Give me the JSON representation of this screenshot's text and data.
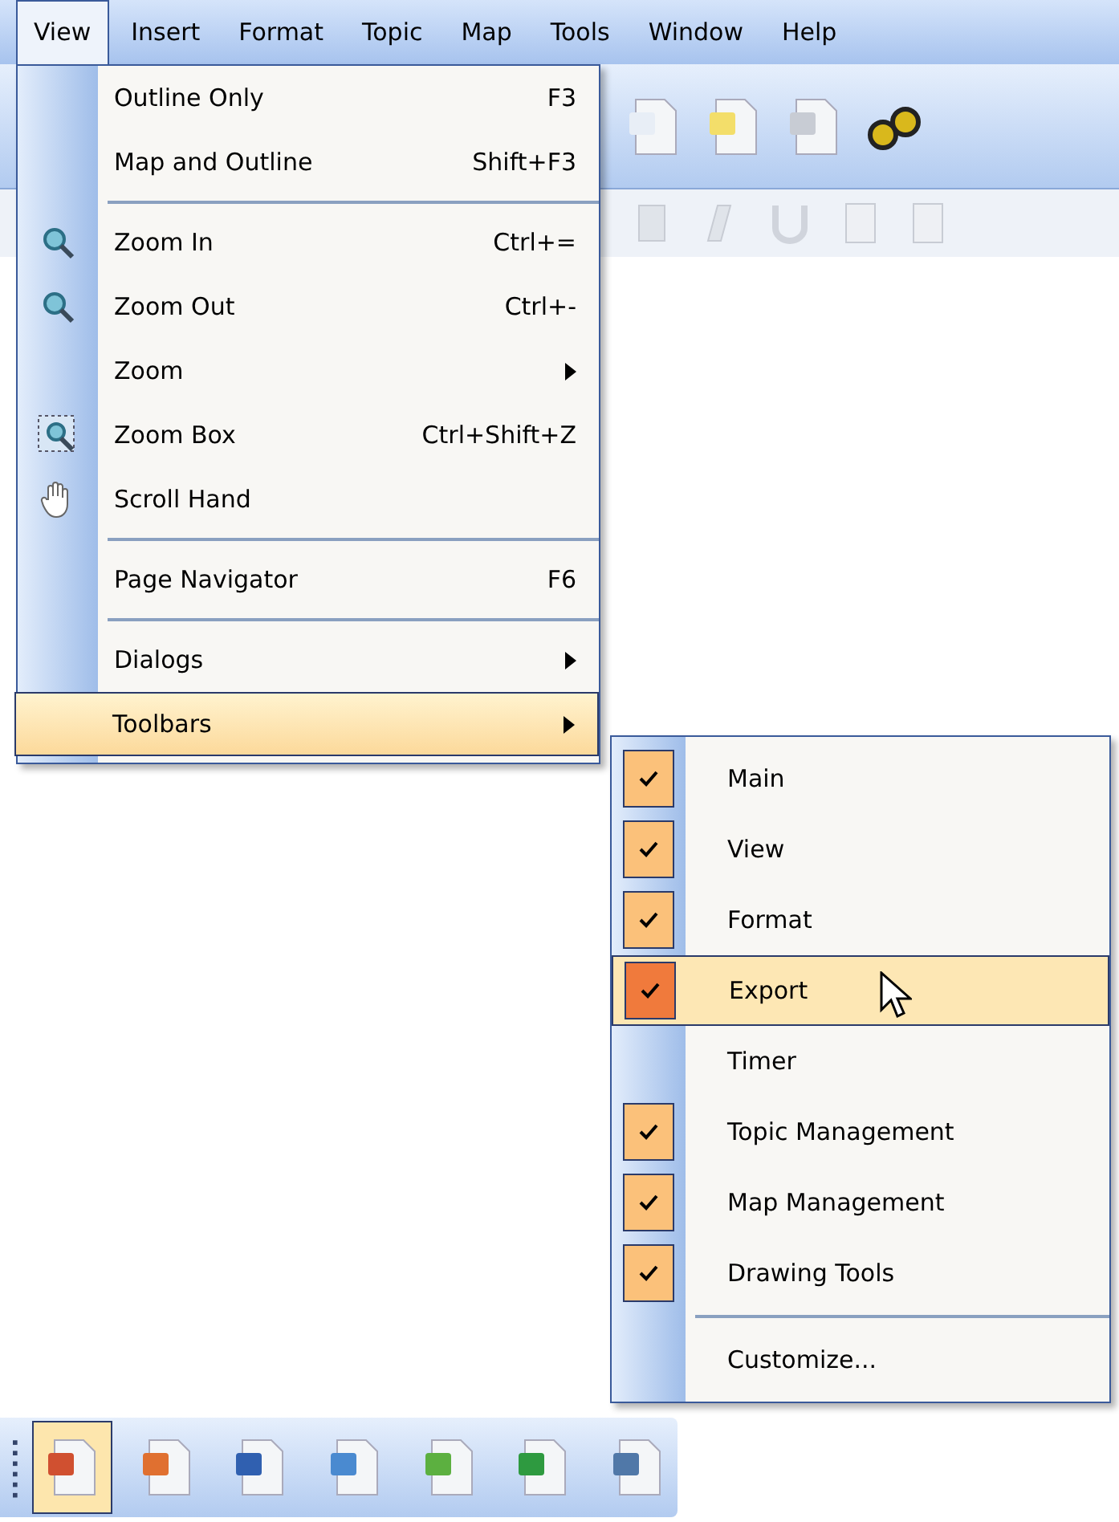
{
  "menubar": [
    {
      "label": "View",
      "selected": true
    },
    {
      "label": "Insert",
      "selected": false
    },
    {
      "label": "Format",
      "selected": false
    },
    {
      "label": "Topic",
      "selected": false
    },
    {
      "label": "Map",
      "selected": false
    },
    {
      "label": "Tools",
      "selected": false
    },
    {
      "label": "Window",
      "selected": false
    },
    {
      "label": "Help",
      "selected": false
    }
  ],
  "view_menu": [
    {
      "kind": "item",
      "label": "Outline Only",
      "shortcut": "F3",
      "selected": false
    },
    {
      "kind": "item",
      "label": "Map and Outline",
      "shortcut": "Shift+F3",
      "selected": false
    },
    {
      "kind": "separator"
    },
    {
      "kind": "item",
      "label": "Zoom In",
      "shortcut": "Ctrl+=",
      "selected": false
    },
    {
      "kind": "item",
      "label": "Zoom Out",
      "shortcut": "Ctrl+-",
      "selected": false
    },
    {
      "kind": "submenu",
      "label": "Zoom",
      "selected": false
    },
    {
      "kind": "item",
      "label": "Zoom Box",
      "shortcut": "Ctrl+Shift+Z",
      "selected": false
    },
    {
      "kind": "item",
      "label": "Scroll Hand",
      "selected": false
    },
    {
      "kind": "separator"
    },
    {
      "kind": "item",
      "label": "Page Navigator",
      "shortcut": "F6",
      "selected": false
    },
    {
      "kind": "separator"
    },
    {
      "kind": "submenu",
      "label": "Dialogs",
      "selected": false
    },
    {
      "kind": "submenu",
      "label": "Toolbars",
      "selected": true
    }
  ],
  "toolbars_submenu": [
    {
      "kind": "toggle",
      "label": "Main",
      "checked": true,
      "selected": false
    },
    {
      "kind": "toggle",
      "label": "View",
      "checked": true,
      "selected": false
    },
    {
      "kind": "toggle",
      "label": "Format",
      "checked": true,
      "selected": false
    },
    {
      "kind": "toggle",
      "label": "Export",
      "checked": true,
      "selected": true
    },
    {
      "kind": "toggle",
      "label": "Timer",
      "checked": false,
      "selected": false
    },
    {
      "kind": "toggle",
      "label": "Topic Management",
      "checked": true,
      "selected": false
    },
    {
      "kind": "toggle",
      "label": "Map Management",
      "checked": true,
      "selected": false
    },
    {
      "kind": "toggle",
      "label": "Drawing Tools",
      "checked": true,
      "selected": false
    },
    {
      "kind": "separator"
    },
    {
      "kind": "command",
      "label": "Customize...",
      "selected": false
    }
  ],
  "export_toolbar": [
    {
      "selected": true
    },
    {
      "selected": false
    },
    {
      "selected": false
    },
    {
      "selected": false
    },
    {
      "selected": false
    },
    {
      "selected": false
    },
    {
      "selected": false
    }
  ]
}
